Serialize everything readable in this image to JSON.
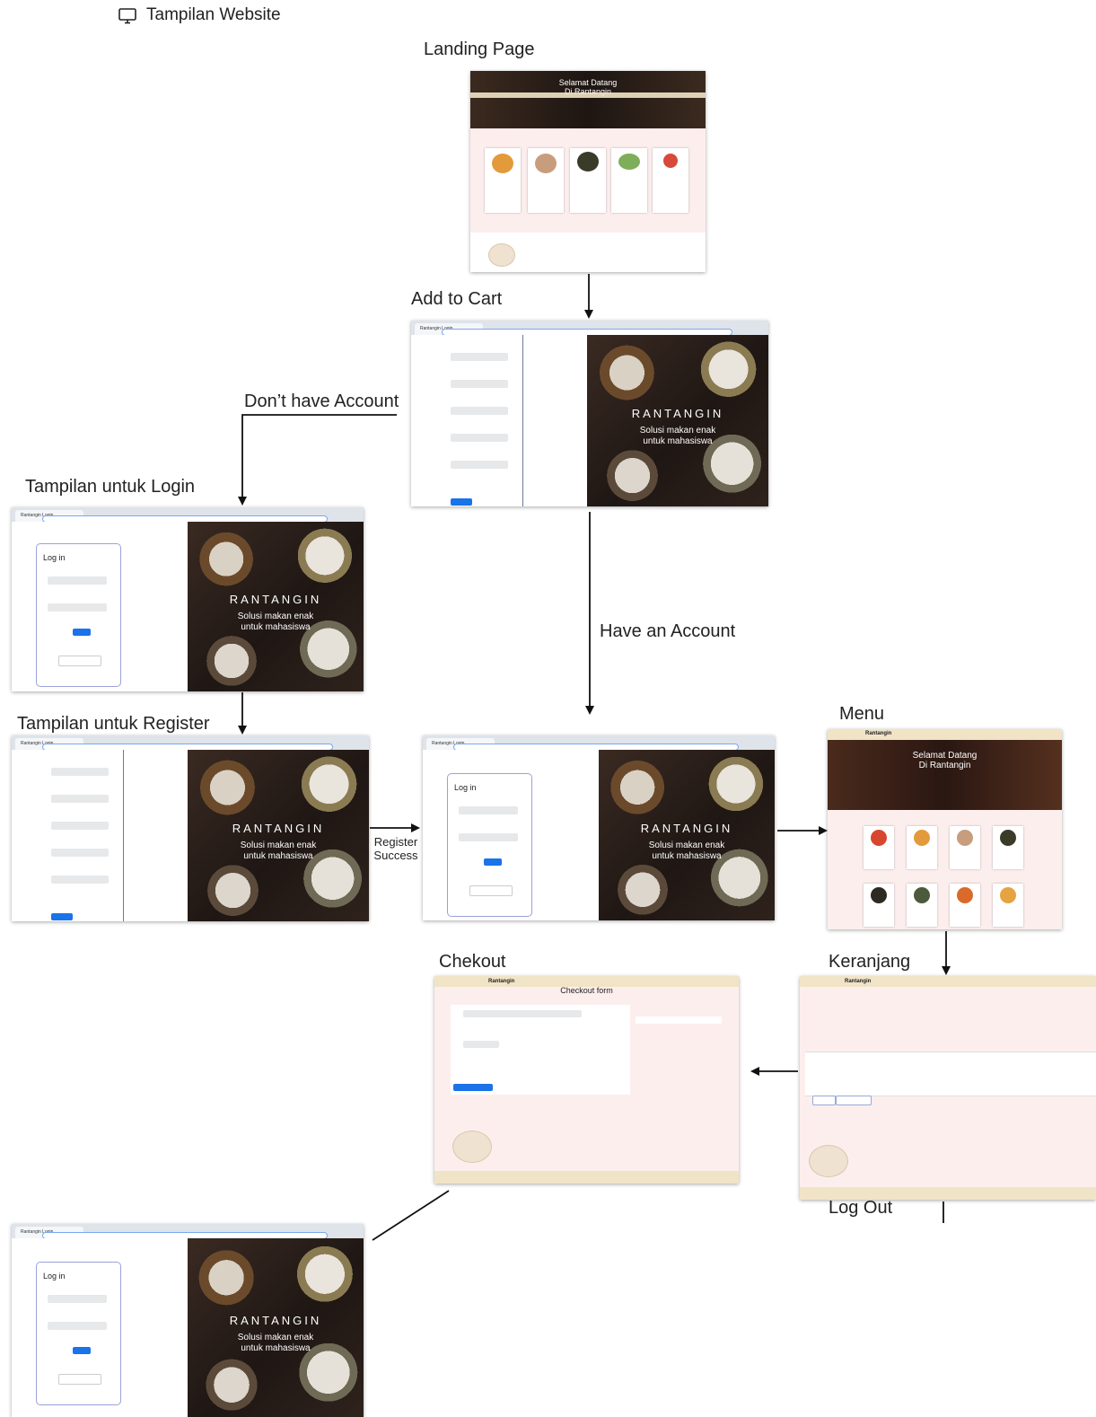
{
  "header": {
    "icon": "monitor-icon",
    "title": "Tampilan Website"
  },
  "labels": {
    "landing": "Landing Page",
    "add_to_cart": "Add to Cart",
    "dont_have_account": "Don’t have Account",
    "login_view": "Tampilan untuk Login",
    "register_view": "Tampilan untuk Register",
    "have_account": "Have an Account",
    "register_success": "Register\nSuccess",
    "menu": "Menu",
    "checkout": "Chekout",
    "cart": "Keranjang",
    "logout": "Log Out"
  },
  "brand": {
    "name": "RANTANGIN",
    "tagline": "Solusi makan enak\nuntuk mahasiswa"
  },
  "login": {
    "title": "Log in"
  },
  "landing_page": {
    "hero": "Selamat Datang\nDi Rantangin"
  },
  "menu_page": {
    "logo": "Rantangin",
    "hero": "Selamat Datang\nDi Rantangin"
  },
  "checkout_page": {
    "logo": "Rantangin",
    "title": "Checkout form"
  },
  "cart_page": {
    "logo": "Rantangin"
  },
  "colors": {
    "accent": "#1a73e8",
    "beige": "#f1e4c6",
    "pink": "#fdeeee"
  }
}
